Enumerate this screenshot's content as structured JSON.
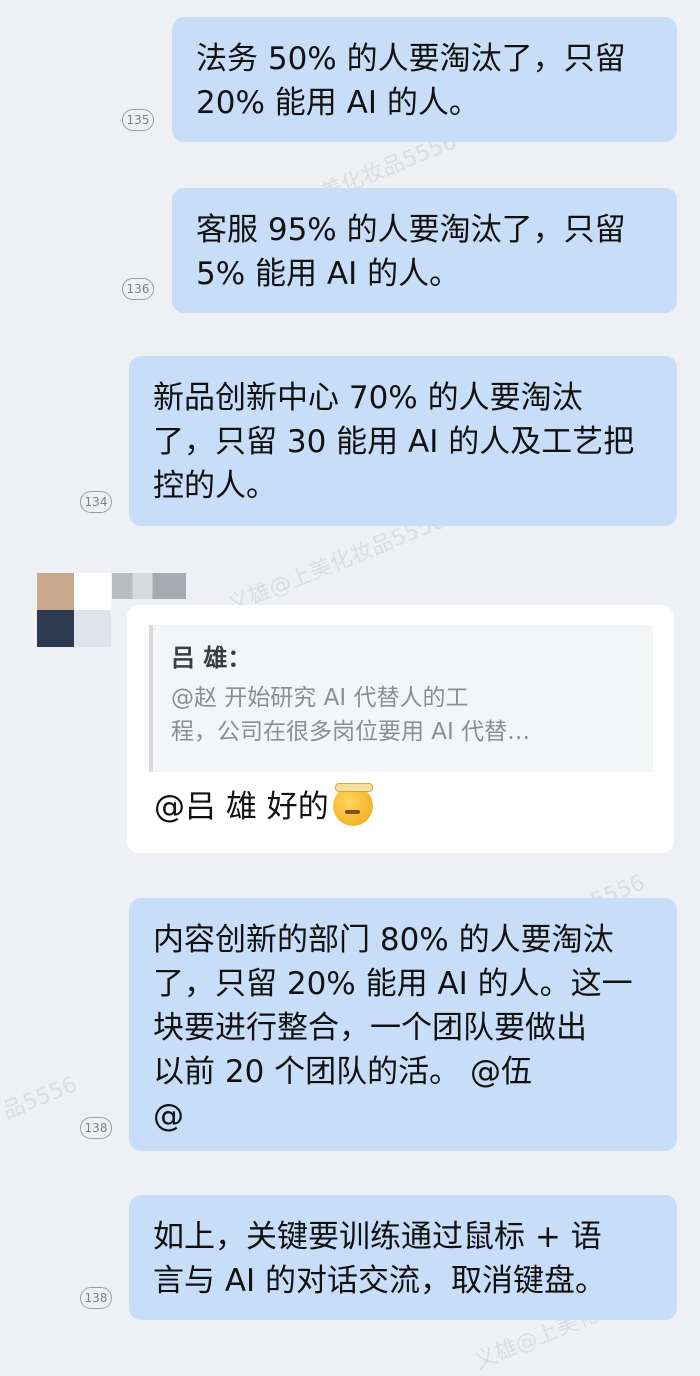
{
  "messages": [
    {
      "text": "法务 50% 的人要淘汰了，只留\n20% 能用 AI 的人。",
      "count": "135"
    },
    {
      "text": "客服 95% 的人要淘汰了，只留\n5% 能用 AI 的人。",
      "count": "136"
    },
    {
      "text": "新品创新中心 70% 的人要淘汰\n了，只留 30 能用 AI 的人及工艺把\n控的人。",
      "count": "134"
    },
    {
      "text": "内容创新的部门 80% 的人要淘汰\n了，只留 20% 能用 AI 的人。这一\n块要进行整合，一个团队要做出\n以前 20 个团队的活。 @伍\n@",
      "count": "138"
    },
    {
      "text": "如上，关键要训练通过鼠标 + 语\n言与 AI 的对话交流，取消键盘。",
      "count": "138"
    }
  ],
  "reply": {
    "quote_author": "吕 雄：",
    "quote_text": "@赵 开始研究 AI 代替人的工\n程，公司在很多岗位要用 AI 代替…",
    "text": "@吕 雄 好的",
    "emoji_icon": "thinking-face-icon"
  },
  "watermarks": [
    "吕义雄@上美化妆品5556",
    "义雄@上美化妆品5556",
    "品5556",
    "5556",
    "义雄@上美化"
  ],
  "colors": {
    "sent_bubble": "#c8def8",
    "received_bubble": "#ffffff",
    "background": "#eef0f3"
  }
}
